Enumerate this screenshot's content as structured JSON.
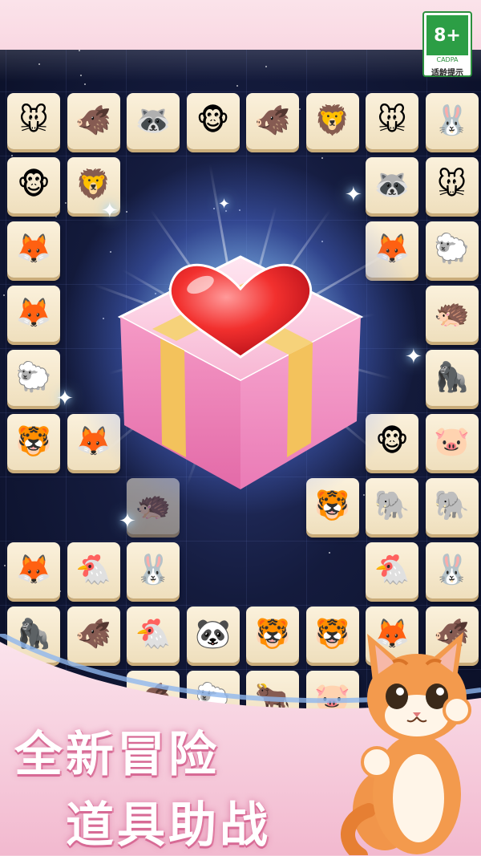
{
  "age_rating": {
    "label": "8+",
    "org": "CADPA",
    "caption": "适龄提示",
    "color": "#2c9e45"
  },
  "slogan": {
    "line1": "全新冒险",
    "line2": "道具助战"
  },
  "feature_item": {
    "name": "gift-box-heart-icon"
  },
  "colors": {
    "tile_face": "#f5e7c8",
    "board_bg": "#141b3d",
    "band_pink": "#f3c9d8"
  },
  "board": {
    "rows": [
      [
        "🐭",
        "🐗",
        "🦝",
        "🐵",
        "🐗",
        "🦁",
        "🐭",
        "🐰"
      ],
      [
        "🐵",
        "🦁",
        "",
        "",
        "",
        "",
        "🦝",
        "🐭"
      ],
      [
        "🦊",
        "",
        "",
        "",
        "",
        "",
        "🦊",
        "🐑"
      ],
      [
        "🦊",
        "",
        "",
        "",
        "",
        "",
        "",
        "🦔"
      ],
      [
        "🐑",
        "",
        "",
        "",
        "",
        "",
        "",
        "🦍"
      ],
      [
        "🐯",
        "🦊",
        "",
        "",
        "",
        "",
        "🐵",
        "🐷"
      ],
      [
        "",
        "",
        "🦔",
        "",
        "",
        "🐯",
        "🐘",
        "🐘"
      ],
      [
        "🦊",
        "🐔",
        "🐰",
        "",
        "",
        "",
        "🐔",
        "🐰"
      ],
      [
        "🦍",
        "🐗",
        "🐔",
        "🐼",
        "🐯",
        "🐯",
        "🦊",
        "🐗"
      ],
      [
        "",
        "",
        "🐗",
        "🐑",
        "🐂",
        "🐷",
        "",
        ""
      ]
    ]
  }
}
